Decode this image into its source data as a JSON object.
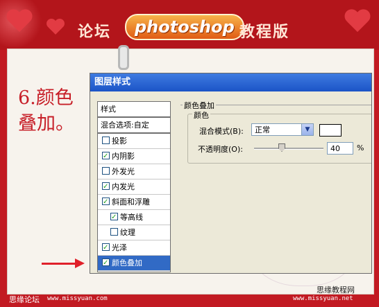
{
  "banner": {
    "text_left": "论坛",
    "logo": "photoshop",
    "text_right": "教程版"
  },
  "step_label_line1": "6.颜色",
  "step_label_line2": "叠加。",
  "dialog": {
    "title": "图层样式",
    "styles_panel": {
      "header": "样式",
      "blend_options": "混合选项:自定",
      "items": [
        {
          "label": "投影",
          "checked": false
        },
        {
          "label": "内阴影",
          "checked": true
        },
        {
          "label": "外发光",
          "checked": false
        },
        {
          "label": "内发光",
          "checked": true
        },
        {
          "label": "斜面和浮雕",
          "checked": true
        },
        {
          "label": "等高线",
          "checked": true
        },
        {
          "label": "纹理",
          "checked": false
        },
        {
          "label": "光泽",
          "checked": true
        },
        {
          "label": "颜色叠加",
          "checked": true
        }
      ]
    },
    "section_title": "颜色叠加",
    "group_title": "颜色",
    "blend_mode_label": "混合模式(B):",
    "blend_mode_value": "正常",
    "swatch_color": "#ffffff",
    "opacity_label": "不透明度(O):",
    "opacity_value": "40",
    "opacity_unit": "%",
    "opacity_slider_value_pct": 40
  },
  "footer": {
    "left_site": "思缘论坛",
    "left_url": "www.missyuan.com",
    "right_site": "思缘教程网",
    "right_url": "www.missyuan.net"
  },
  "colors": {
    "frame_red": "#c21a22",
    "paper": "#f7f3ed",
    "selection_blue": "#316ac5",
    "titlebar_blue": "#1b54c7",
    "step_text_red": "#c71f28"
  }
}
